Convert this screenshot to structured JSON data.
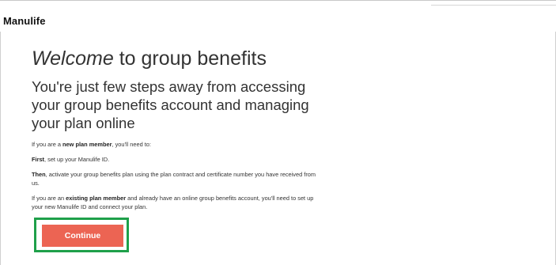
{
  "header": {
    "brand": "Manulife"
  },
  "main": {
    "title_emphasis": "Welcome",
    "title_rest": " to group benefits",
    "subtitle": "You're just few steps away from accessing your group benefits account and managing your plan online",
    "new_member": {
      "prefix": "If you are a ",
      "bold": "new plan member",
      "suffix": ", you'll need to:"
    },
    "first": {
      "bold": "First",
      "text": ", set up your Manulife ID."
    },
    "then": {
      "bold": "Then",
      "text": ", activate your group benefits plan using the plan contract and certificate number you have received from us."
    },
    "existing": {
      "prefix": "If you are an ",
      "bold": "existing plan member",
      "suffix": " and already have an online group benefits account, you'll need to set up your new Manulife ID and connect your plan."
    },
    "continue_label": "Continue"
  },
  "colors": {
    "button": "#ec6453",
    "highlight": "#1fa04a"
  }
}
